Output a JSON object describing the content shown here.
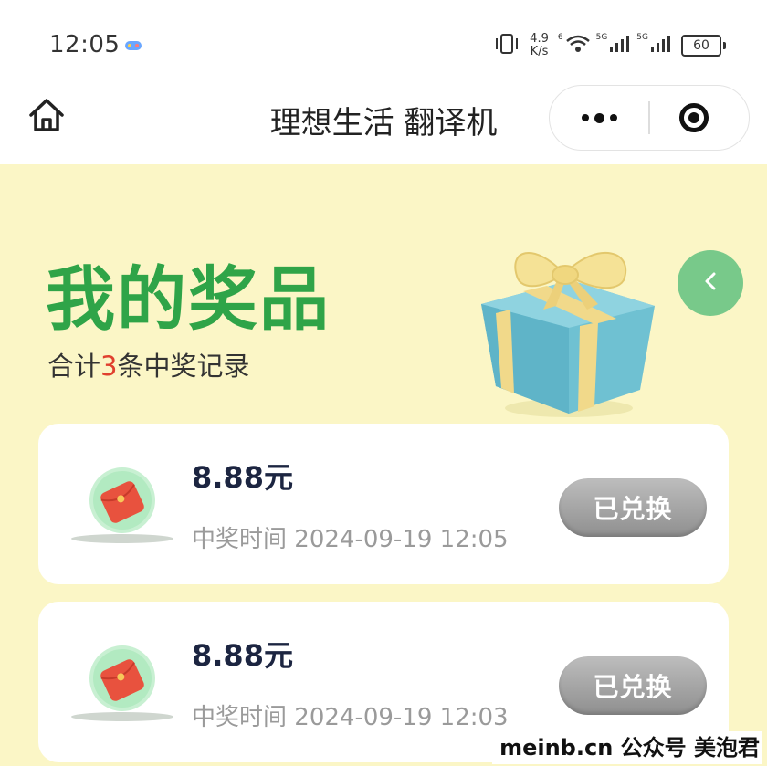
{
  "status_bar": {
    "time": "12:05",
    "speed_value": "4.9",
    "speed_unit": "K/s",
    "net_1": "6",
    "net_2": "5G",
    "net_3": "5G",
    "battery": "60",
    "icons": [
      "game-icon",
      "vibrate-icon",
      "wifi-icon",
      "signal-icon",
      "signal-icon",
      "battery-icon"
    ]
  },
  "nav": {
    "title": "理想生活 翻译机",
    "icons": [
      "home-icon",
      "more-icon",
      "close-icon"
    ]
  },
  "header": {
    "title": "我的奖品",
    "summary_prefix": "合计",
    "summary_count": "3",
    "summary_suffix": "条中奖记录",
    "back_icon": "chevron-left-icon"
  },
  "prizes": [
    {
      "amount": "8.88元",
      "time_label": "中奖时间",
      "time": "2024-09-19 12:05",
      "button": "已兑换",
      "icon": "red-envelope-icon"
    },
    {
      "amount": "8.88元",
      "time_label": "中奖时间",
      "time": "2024-09-19 12:03",
      "button": "已兑换",
      "icon": "red-envelope-icon"
    }
  ],
  "watermark": "meinb.cn  公众号 美泡君",
  "colors": {
    "page_bg": "#fbf6c6",
    "title_green": "#2fa448",
    "count_red": "#e0402e",
    "back_button": "#78c98a",
    "button_gray": "#9e9e9e"
  }
}
